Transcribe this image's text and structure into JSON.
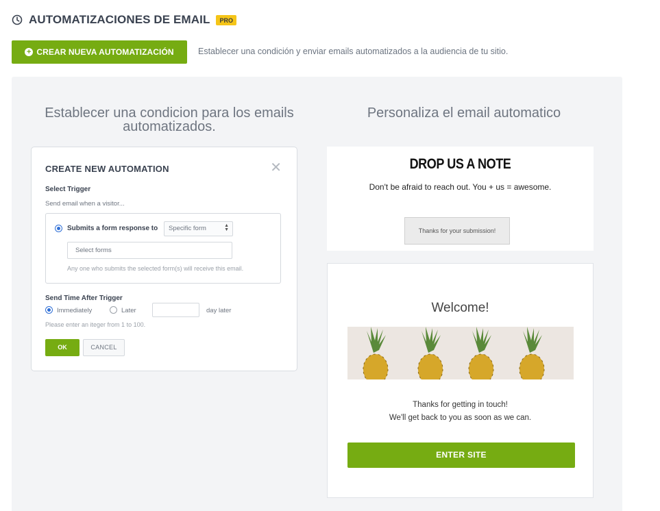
{
  "header": {
    "title": "AUTOMATIZACIONES DE EMAIL",
    "badge": "PRO",
    "icon": "clock-icon"
  },
  "toolbar": {
    "create_label": "CREAR NUEVA AUTOMATIZACIÓN",
    "description": "Establecer una condición y enviar emails automatizados a la audiencia de tu sitio."
  },
  "colors": {
    "accent": "#76ac12",
    "pro_badge": "#f5c518",
    "panel_bg": "#f3f4f6"
  },
  "left_column": {
    "title_line1": "Establecer una condicion para los emails",
    "title_line2": "automatizados."
  },
  "right_column": {
    "title": "Personaliza el email automatico"
  },
  "modal": {
    "title": "CREATE NEW AUTOMATION",
    "select_trigger_label": "Select Trigger",
    "send_when": "Send email when a visitor...",
    "trigger_option": "Submits a form response to",
    "form_select_value": "Specific form",
    "forms_placeholder": "Select forms",
    "forms_hint": "Any one who submits the selected form(s) will receive this email.",
    "send_time_label": "Send Time After Trigger",
    "immediately": "Immediately",
    "later": "Later",
    "day_later": "day later",
    "integer_hint": "Please enter an iteger  from 1 to 100.",
    "ok": "OK",
    "cancel": "CANCEL"
  },
  "preview1": {
    "heading": "DROP US A NOTE",
    "text": "Don't be afraid to reach out. You + us = awesome.",
    "button": "Thanks for your submission!"
  },
  "preview2": {
    "heading": "Welcome!",
    "line1": "Thanks for getting in touch!",
    "line2": "We'll get back to you as soon as we can.",
    "button": "ENTER SITE"
  }
}
